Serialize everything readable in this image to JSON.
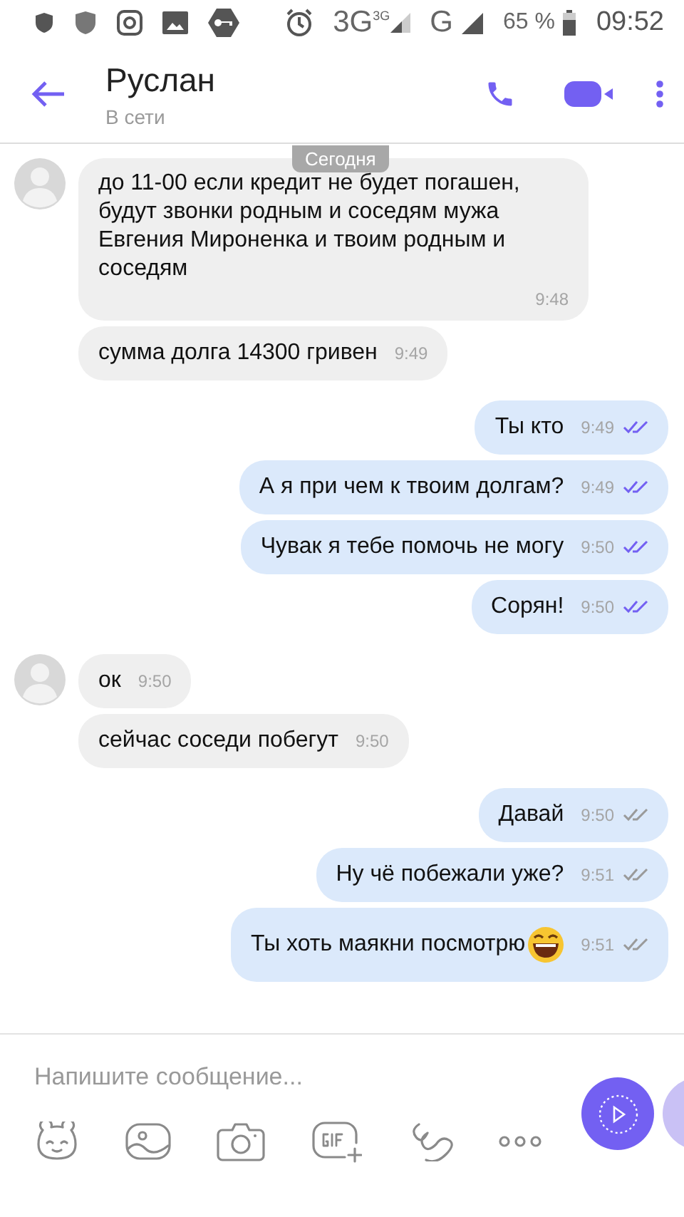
{
  "status_bar": {
    "network": "3G",
    "network_small": "3G",
    "network_2": "G",
    "battery": "65 %",
    "time": "09:52"
  },
  "header": {
    "name": "Руслан",
    "status": "В сети"
  },
  "date_label": "Сегодня",
  "messages": [
    {
      "kind": "incoming",
      "avatar": true,
      "text": "до 11-00 если кредит не будет погашен, будут звонки родным и соседям мужа Евгения Мироненка и твоим родным и соседям",
      "time": "9:48"
    },
    {
      "kind": "incoming",
      "avatar": false,
      "text": "сумма долга 14300 гривен",
      "time": "9:49"
    },
    {
      "kind": "outgoing",
      "text": "Ты кто",
      "time": "9:49",
      "seen": true
    },
    {
      "kind": "outgoing",
      "text": "А я при чем к твоим долгам?",
      "time": "9:49",
      "seen": true
    },
    {
      "kind": "outgoing",
      "text": "Чувак я тебе помочь не могу",
      "time": "9:50",
      "seen": true
    },
    {
      "kind": "outgoing",
      "text": "Сорян!",
      "time": "9:50",
      "seen": true
    },
    {
      "kind": "incoming",
      "avatar": true,
      "text": "ок",
      "time": "9:50"
    },
    {
      "kind": "incoming",
      "avatar": false,
      "text": "сейчас соседи побегут",
      "time": "9:50"
    },
    {
      "kind": "outgoing",
      "text": "Давай",
      "time": "9:50",
      "seen": false
    },
    {
      "kind": "outgoing",
      "text": "Ну чё побежали уже?",
      "time": "9:51",
      "seen": false
    },
    {
      "kind": "outgoing",
      "text": "Ты хоть маякни посмотрю",
      "time": "9:51",
      "seen": false,
      "emoji": true
    }
  ],
  "composer": {
    "placeholder": "Напишите сообщение..."
  }
}
